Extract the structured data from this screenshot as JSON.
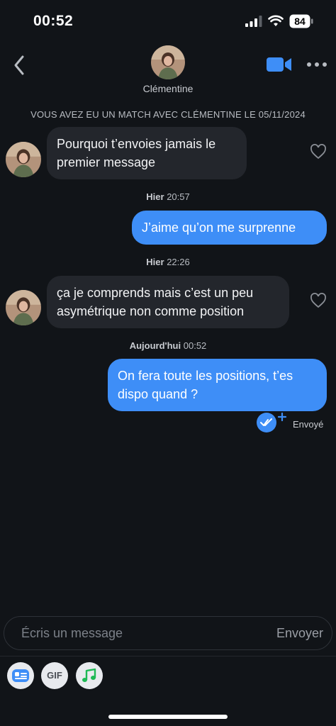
{
  "status_bar": {
    "time": "00:52",
    "battery": "84"
  },
  "header": {
    "contact_name": "Clémentine"
  },
  "match_banner": "VOUS AVEZ EU UN MATCH AVEC CLÉMENTINE LE 05/11/2024",
  "messages": [
    {
      "direction": "incoming",
      "text_line1": "Pourquoi t’envoies jamais le",
      "text_line2": "premier message"
    },
    {
      "timestamp_day": "Hier",
      "timestamp_time": "20:57"
    },
    {
      "direction": "outgoing",
      "text_line1": "J’aime qu’on me surprenne"
    },
    {
      "timestamp_day": "Hier",
      "timestamp_time": "22:26"
    },
    {
      "direction": "incoming",
      "text_line1": "ça je comprends mais c’est un peu",
      "text_line2": "asymétrique non comme position"
    },
    {
      "timestamp_day": "Aujourd'hui",
      "timestamp_time": "00:52"
    },
    {
      "direction": "outgoing",
      "text_line1": "On fera toute les positions, t’es",
      "text_line2": "dispo quand ?"
    }
  ],
  "delivery_status": "Envoyé",
  "composer": {
    "placeholder": "Écris un message",
    "send_label": "Envoyer"
  },
  "toolbar": {
    "gif_label": "GIF"
  },
  "colors": {
    "background": "#111418",
    "incoming_bubble": "#23262c",
    "outgoing_bubble": "#3e8ef7",
    "accent": "#3e8ef7",
    "music": "#1db954"
  }
}
